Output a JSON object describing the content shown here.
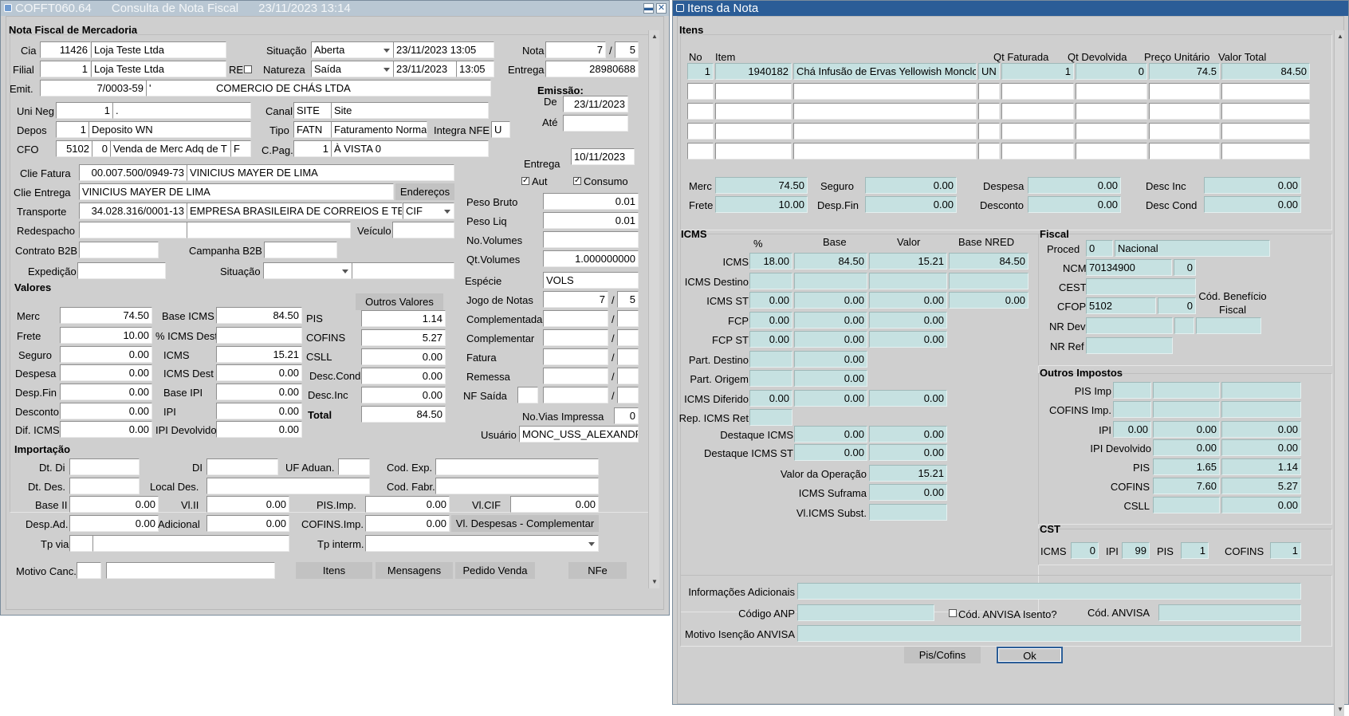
{
  "left_window": {
    "title": "COFFT060.64      Consulta de Nota Fiscal      23/11/2023 13:14",
    "minimize_glyph": "▬",
    "close_glyph": "✕",
    "section_header": "Nota Fiscal de Mercadoria",
    "header": {
      "cia_label": "Cia",
      "cia_code": "11426",
      "cia_name": "Loja Teste Ltda",
      "filial_label": "Filial",
      "filial_code": "1",
      "filial_name": "Loja Teste Ltda",
      "re_label": "RE",
      "situacao_label": "Situação",
      "situacao_value": "Aberta",
      "situacao_date": "23/11/2023 13:05",
      "natureza_label": "Natureza",
      "natureza_value": "Saída",
      "natureza_date": "23/11/2023",
      "natureza_time": "13:05",
      "nota_label": "Nota",
      "nota_number": "7",
      "slash": "/",
      "nota_serie": "5",
      "entrega_label": "Entrega",
      "entrega_value": "28980688",
      "emit_label": "Emit.",
      "emit_doc": "7/0003-59",
      "emit_code": "'",
      "emit_name": "COMERCIO DE CHÁS LTDA",
      "emissao_label": "Emissão:",
      "de_label": "De",
      "de_value": "23/11/2023",
      "ate_label": "Até",
      "ate_value": "",
      "unineg_label": "Uni Neg",
      "unineg_code": "1",
      "unineg_name": ".",
      "canal_label": "Canal",
      "canal_code": "SITE",
      "canal_name": "Site",
      "depos_label": "Depos",
      "depos_code": "1",
      "depos_name": "Deposito WN",
      "tipo_label": "Tipo",
      "tipo_code": "FATN",
      "tipo_name": "Faturamento Norma",
      "integra_label": "Integra NFE",
      "integra_value": "U",
      "cfo_label": "CFO",
      "cfo_code": "5102",
      "cfo_seq": "0",
      "cfo_name": "Venda de Merc Adq de T",
      "cfo_flag": "F",
      "cpag_label": "C.Pag.",
      "cpag_code": "1",
      "cpag_name": "À VISTA 0",
      "entrega2_label": "Entrega",
      "entrega2_value": "10/11/2023",
      "aut_label": "Aut",
      "consumo_label": "Consumo"
    },
    "cliente": {
      "fatura_label": "Clie Fatura",
      "fatura_doc": "00.007.500/0949-73",
      "fatura_name": "VINICIUS MAYER DE LIMA",
      "entrega_label": "Clie Entrega",
      "entrega_name": "VINICIUS MAYER DE LIMA",
      "enderecos_btn": "Endereços",
      "transporte_label": "Transporte",
      "transporte_doc": "34.028.316/0001-13",
      "transporte_name": "EMPRESA BRASILEIRA DE CORREIOS E TE",
      "transporte_frete": "CIF",
      "redespacho_label": "Redespacho",
      "veiculo_label": "Veículo",
      "contrato_label": "Contrato B2B",
      "campanha_label": "Campanha B2B",
      "expedicao_label": "Expedição",
      "situacao_label": "Situação"
    },
    "pesos": {
      "peso_bruto_label": "Peso Bruto",
      "peso_bruto": "0.01",
      "peso_liq_label": "Peso Liq",
      "peso_liq": "0.01",
      "no_volumes_label": "No.Volumes",
      "no_volumes": "",
      "qt_volumes_label": "Qt.Volumes",
      "qt_volumes": "1.000000000",
      "especie_label": "Espécie",
      "especie": "VOLS",
      "jogo_label": "Jogo de Notas",
      "jogo_num": "7",
      "jogo_serie": "5",
      "complementada_label": "Complementada",
      "complementar_label": "Complementar",
      "fatura_label": "Fatura",
      "remessa_label": "Remessa",
      "nfsaida_label": "NF Saída",
      "novias_label": "No.Vias Impressa",
      "novias": "0",
      "usuario_label": "Usuário",
      "usuario": "MONC_USS_ALEXANDR"
    },
    "valores": {
      "header": "Valores",
      "outros_btn": "Outros Valores",
      "merc_label": "Merc",
      "merc": "74.50",
      "frete_label": "Frete",
      "frete": "10.00",
      "seguro_label": "Seguro",
      "seguro": "0.00",
      "despesa_label": "Despesa",
      "despesa": "0.00",
      "despfin_label": "Desp.Fin",
      "despfin": "0.00",
      "desconto_label": "Desconto",
      "desconto": "0.00",
      "difcms_label": "Dif. ICMS",
      "difcms": "0.00",
      "baseicms_label": "Base ICMS",
      "baseicms": "84.50",
      "icmsdest_pct_label": "% ICMS Dest",
      "icmsdest_pct": "",
      "icms_label": "ICMS",
      "icms": "15.21",
      "icmsdest_label": "ICMS Dest",
      "icmsdest": "0.00",
      "baseipi_label": "Base IPI",
      "baseipi": "0.00",
      "ipi_label": "IPI",
      "ipi": "0.00",
      "ipidev_label": "IPI Devolvido",
      "ipidev": "0.00",
      "pis_label": "PIS",
      "pis": "1.14",
      "cofins_label": "COFINS",
      "cofins": "5.27",
      "csll_label": "CSLL",
      "csll": "0.00",
      "desccond_label": "Desc.Cond",
      "desccond": "0.00",
      "descinc_label": "Desc.Inc",
      "descinc": "0.00",
      "total_label": "Total",
      "total": "84.50"
    },
    "importacao": {
      "header": "Importação",
      "dtdi_label": "Dt. Di",
      "di_label": "DI",
      "ufaduan_label": "UF Aduan.",
      "codexp_label": "Cod. Exp.",
      "dtdes_label": "Dt. Des.",
      "localdes_label": "Local Des.",
      "codfabr_label": "Cod. Fabr.",
      "baseii_label": "Base II",
      "baseii": "0.00",
      "vlii_label": "Vl.II",
      "vlii": "0.00",
      "pisimp_label": "PIS.Imp.",
      "pisimp": "0.00",
      "vlcif_label": "Vl.CIF",
      "vlcif": "0.00",
      "despad_label": "Desp.Ad.",
      "despad": "0.00",
      "adicional_label": "Adicional",
      "adicional": "0.00",
      "cofinsimp_label": "COFINS.Imp.",
      "cofinsimp": "0.00",
      "vldesp_btn": "Vl. Despesas - Complementar",
      "tpvia_label": "Tp via",
      "tpinterm_label": "Tp interm."
    },
    "footer": {
      "motivo_label": "Motivo Canc.",
      "itens_btn": "Itens",
      "mensagens_btn": "Mensagens",
      "pedido_btn": "Pedido Venda",
      "nfe_btn": "NFe"
    }
  },
  "right_window": {
    "title": "Itens da Nota",
    "itens_header": "Itens",
    "columns": {
      "no": "No",
      "item": "Item",
      "qt_fat": "Qt Faturada",
      "qt_dev": "Qt Devolvida",
      "preco": "Preço Unitário",
      "valor": "Valor Total"
    },
    "row": {
      "no": "1",
      "code": "1940182",
      "desc": "Chá Infusão de Ervas Yellowish Monclc",
      "un": "UN",
      "qt_fat": "1",
      "qt_dev": "0",
      "preco": "74.5",
      "valor": "84.50"
    },
    "totais": {
      "merc_label": "Merc",
      "merc": "74.50",
      "seguro_label": "Seguro",
      "seguro": "0.00",
      "despesa_label": "Despesa",
      "despesa": "0.00",
      "descinc_label": "Desc Inc",
      "descinc": "0.00",
      "frete_label": "Frete",
      "frete": "10.00",
      "despfin_label": "Desp.Fin",
      "despfin": "0.00",
      "desconto_label": "Desconto",
      "desconto": "0.00",
      "desccond_label": "Desc Cond",
      "desccond": "0.00"
    },
    "icms": {
      "header": "ICMS",
      "col_pct": "%",
      "col_base": "Base",
      "col_valor": "Valor",
      "col_nred": "Base NRED",
      "rows": [
        {
          "label": "ICMS",
          "pct": "18.00",
          "base": "84.50",
          "valor": "15.21",
          "nred": "84.50"
        },
        {
          "label": "ICMS Destino",
          "pct": "",
          "base": "",
          "valor": "",
          "nred": ""
        },
        {
          "label": "ICMS ST",
          "pct": "0.00",
          "base": "0.00",
          "valor": "0.00",
          "nred": "0.00"
        },
        {
          "label": "FCP",
          "pct": "0.00",
          "base": "0.00",
          "valor": "0.00"
        },
        {
          "label": "FCP ST",
          "pct": "0.00",
          "base": "0.00",
          "valor": "0.00"
        },
        {
          "label": "Part. Destino",
          "pct": "",
          "base": "0.00"
        },
        {
          "label": "Part. Origem",
          "pct": "",
          "base": "0.00"
        },
        {
          "label": "ICMS Diferido",
          "pct": "0.00",
          "base": "0.00",
          "valor": "0.00"
        },
        {
          "label": "Rep. ICMS  Ret",
          "pct": ""
        }
      ],
      "destaque_label": "Destaque ICMS",
      "destaque_base": "0.00",
      "destaque_valor": "0.00",
      "destaque_st_label": "Destaque ICMS ST",
      "destaque_st_base": "0.00",
      "destaque_st_valor": "0.00",
      "valor_op_label": "Valor da Operação",
      "valor_op": "15.21",
      "suframa_label": "ICMS Suframa",
      "suframa": "0.00",
      "vlsubst_label": "Vl.ICMS Subst.",
      "vlsubst": ""
    },
    "fiscal": {
      "header": "Fiscal",
      "proced_label": "Proced",
      "proced_code": "0",
      "proced_name": "Nacional",
      "ncm_label": "NCM",
      "ncm": "70134900",
      "ncm_ex": "0",
      "cest_label": "CEST",
      "cfop_label": "CFOP",
      "cfop": "5102",
      "cfop_seq": "0",
      "beneficio_label": "Cód. Benefício Fiscal",
      "nrdev_label": "NR Dev",
      "nrref_label": "NR Ref"
    },
    "outros": {
      "header": "Outros Impostos",
      "pisimp_label": "PIS Imp",
      "cofinsimp_label": "COFINS Imp.",
      "ipi_label": "IPI",
      "ipi_pct": "0.00",
      "ipi_base": "0.00",
      "ipi_valor": "0.00",
      "ipidev_label": "IPI Devolvido",
      "ipidev_base": "0.00",
      "ipidev_valor": "0.00",
      "pis_label": "PIS",
      "pis_pct": "1.65",
      "pis_valor": "1.14",
      "cofins_label": "COFINS",
      "cofins_pct": "7.60",
      "cofins_valor": "5.27",
      "csll_label": "CSLL",
      "csll_valor": "0.00"
    },
    "cst": {
      "header": "CST",
      "icms_label": "ICMS",
      "icms": "0",
      "ipi_label": "IPI",
      "ipi": "99",
      "pis_label": "PIS",
      "pis": "1",
      "cofins_label": "COFINS",
      "cofins": "1"
    },
    "adicionais": {
      "info_label": "Informações Adicionais",
      "anp_label": "Código ANP",
      "anvisa_isento_label": "Cód. ANVISA Isento?",
      "anvisa_label": "Cód. ANVISA",
      "motivo_label": "Motivo Isenção ANVISA"
    },
    "buttons": {
      "piscofins": "Pis/Cofins",
      "ok": "Ok"
    }
  }
}
